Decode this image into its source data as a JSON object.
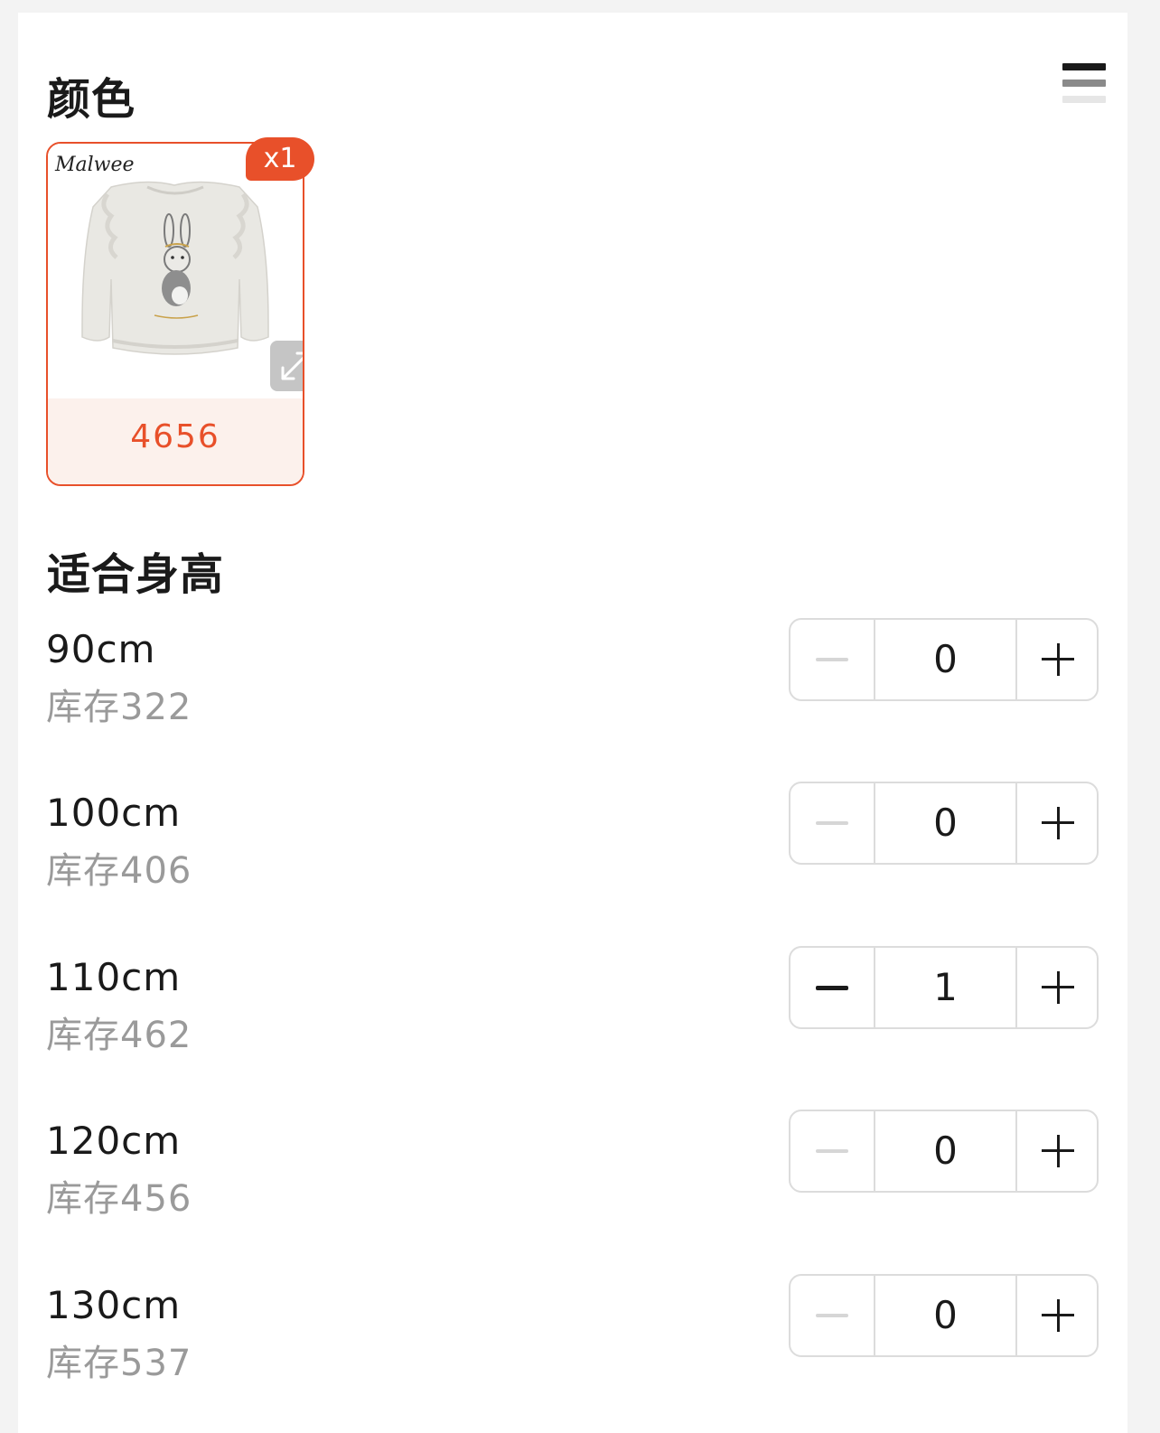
{
  "color_section": {
    "title": "颜色",
    "swatch": {
      "label": "4656",
      "brand_text": "Malwee",
      "selected_count": "x1"
    }
  },
  "height_section": {
    "title": "适合身高",
    "sizes": [
      {
        "name": "90cm",
        "stock": "库存322",
        "qty": "0"
      },
      {
        "name": "100cm",
        "stock": "库存406",
        "qty": "0"
      },
      {
        "name": "110cm",
        "stock": "库存462",
        "qty": "1"
      },
      {
        "name": "120cm",
        "stock": "库存456",
        "qty": "0"
      },
      {
        "name": "130cm",
        "stock": "库存537",
        "qty": "0"
      }
    ]
  },
  "icons": {
    "layout_toggle": "list-layout-icon",
    "expand": "expand-icon",
    "minus": "minus-icon",
    "plus": "plus-icon"
  },
  "colors": {
    "accent": "#e8502a",
    "accent_light": "#fcf1ec",
    "muted_text": "#9a9a9a",
    "border": "#dcdcdc"
  }
}
